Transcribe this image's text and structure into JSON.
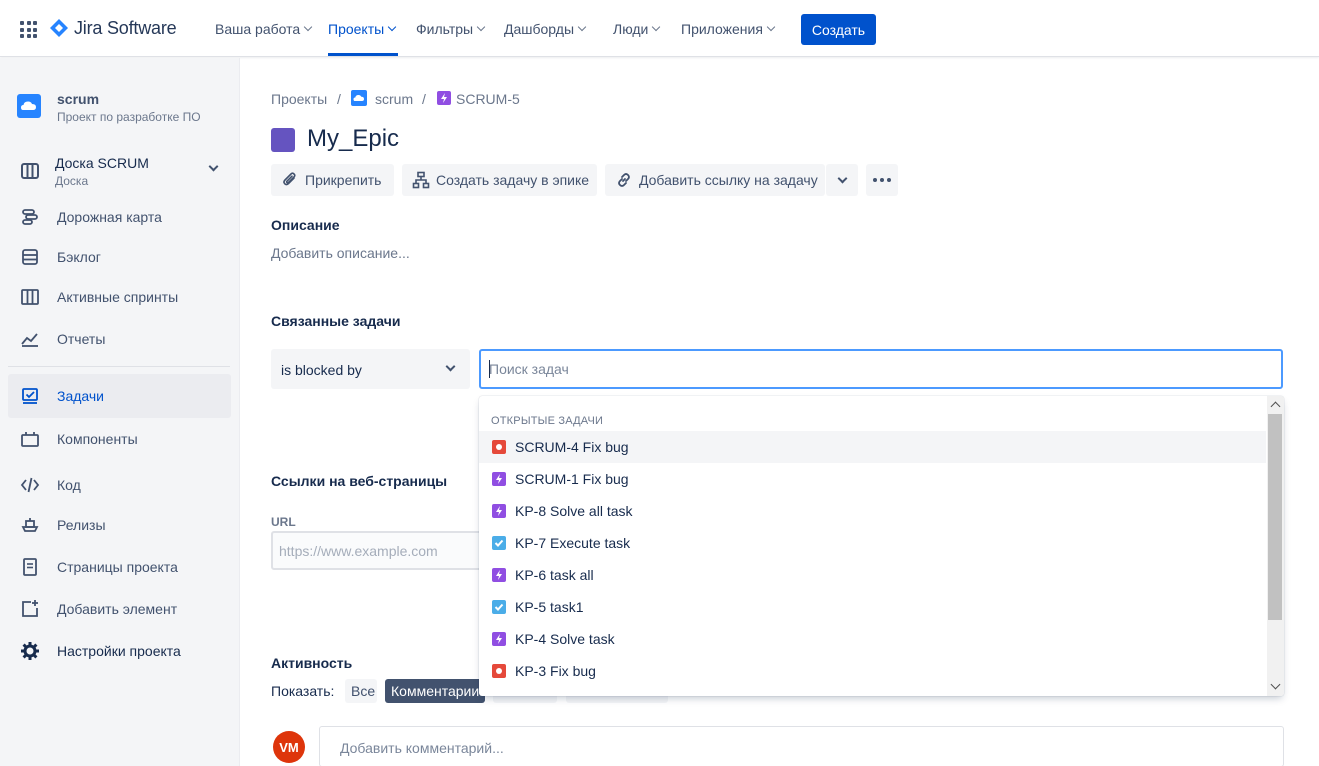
{
  "brand": {
    "name": "Jira Software"
  },
  "nav": {
    "items": [
      {
        "label": "Ваша работа"
      },
      {
        "label": "Проекты"
      },
      {
        "label": "Фильтры"
      },
      {
        "label": "Дашборды"
      },
      {
        "label": "Люди"
      },
      {
        "label": "Приложения"
      }
    ],
    "active": "Проекты",
    "create_label": "Создать"
  },
  "sidebar": {
    "project_name": "scrum",
    "project_type": "Проект по разработке ПО",
    "board": {
      "label": "Доска SCRUM",
      "sub": "Доска"
    },
    "items": [
      {
        "label": "Дорожная карта",
        "icon": "roadmap-icon"
      },
      {
        "label": "Бэклог",
        "icon": "backlog-icon"
      },
      {
        "label": "Активные спринты",
        "icon": "sprints-icon"
      },
      {
        "label": "Отчеты",
        "icon": "reports-icon"
      },
      {
        "label": "Задачи",
        "icon": "issues-icon"
      },
      {
        "label": "Компоненты",
        "icon": "components-icon"
      },
      {
        "label": "Код",
        "icon": "code-icon"
      },
      {
        "label": "Релизы",
        "icon": "releases-icon"
      },
      {
        "label": "Страницы проекта",
        "icon": "pages-icon"
      },
      {
        "label": "Добавить элемент",
        "icon": "add-item-icon"
      },
      {
        "label": "Настройки проекта",
        "icon": "gear-icon"
      }
    ],
    "active": "Задачи"
  },
  "breadcrumb": {
    "projects": "Проекты",
    "project": "scrum",
    "issue": "SCRUM-5"
  },
  "issue": {
    "title": "My_Epic",
    "actions": {
      "attach": "Прикрепить",
      "create_in_epic": "Создать задачу в эпике",
      "add_link": "Добавить ссылку на задачу"
    }
  },
  "description": {
    "heading": "Описание",
    "placeholder": "Добавить описание..."
  },
  "linked": {
    "heading": "Связанные задачи",
    "relation": "is blocked by",
    "search_placeholder": "Поиск задач"
  },
  "dropdown": {
    "section": "ОТКРЫТЫЕ ЗАДАЧИ",
    "items": [
      {
        "text": "SCRUM-4 Fix bug",
        "type": "bug"
      },
      {
        "text": "SCRUM-1 Fix bug",
        "type": "epic"
      },
      {
        "text": "KP-8 Solve all task",
        "type": "epic"
      },
      {
        "text": "KP-7 Execute task",
        "type": "task"
      },
      {
        "text": "KP-6 task all",
        "type": "epic"
      },
      {
        "text": "KP-5 task1",
        "type": "task"
      },
      {
        "text": "KP-4 Solve task",
        "type": "epic"
      },
      {
        "text": "KP-3 Fix bug",
        "type": "bug"
      }
    ]
  },
  "weblinks": {
    "heading": "Ссылки на веб-страницы",
    "url_label": "URL",
    "url_placeholder": "https://www.example.com"
  },
  "activity": {
    "heading": "Активность",
    "show_label": "Показать:",
    "all_label": "Все",
    "comments_label": "Комментарии",
    "avatar_initials": "VM",
    "comment_placeholder": "Добавить комментарий..."
  },
  "colors": {
    "accent": "#0052CC",
    "epic": "#6554C0",
    "bug": "#E5493A",
    "task": "#4BADE8",
    "subtask_epic": "#904EE2"
  }
}
